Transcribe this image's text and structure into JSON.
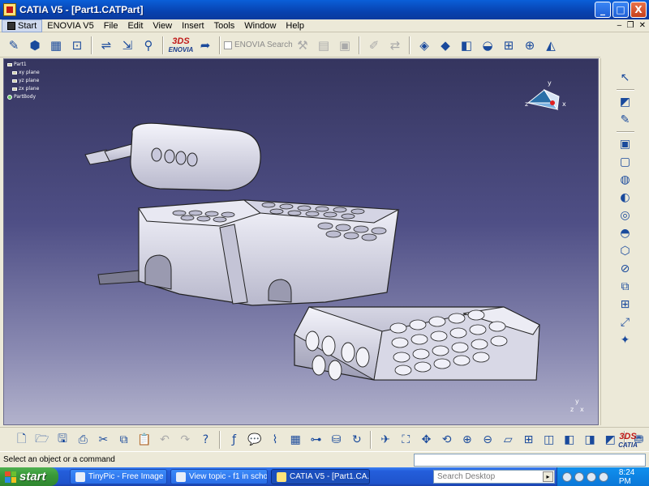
{
  "window": {
    "title": "CATIA V5 - [Part1.CATPart]",
    "buttons": {
      "minimize": "_",
      "maximize": "□",
      "close": "X"
    }
  },
  "menu": {
    "items": [
      "Start",
      "ENOVIA V5",
      "File",
      "Edit",
      "View",
      "Insert",
      "Tools",
      "Window",
      "Help"
    ]
  },
  "toolbar": {
    "enovia_logo": "ENOVIA",
    "enovia_search": "ENOVIA Search ..."
  },
  "spec_tree": {
    "root": "Part1",
    "children": [
      "xy plane",
      "yz plane",
      "zx plane",
      "PartBody"
    ]
  },
  "compass": {
    "y": "y",
    "x": "x",
    "z": "z"
  },
  "axis": {
    "y": "y",
    "z": "z",
    "x": "x"
  },
  "logo": {
    "catia": "CATIA"
  },
  "status": {
    "prompt": "Select an object or a command",
    "command_value": ""
  },
  "taskbar": {
    "start": "start",
    "tasks": [
      {
        "label": "TinyPic - Free Image ...",
        "active": false
      },
      {
        "label": "View topic - f1 in scho...",
        "active": false
      },
      {
        "label": "CATIA V5 - [Part1.CA...",
        "active": true
      }
    ],
    "search_placeholder": "Search Desktop",
    "clock": "8:24 PM"
  },
  "colors": {
    "viewport_top": "#35355f",
    "viewport_bottom": "#b2b2cc",
    "model_fill": "#e6e6f0",
    "title_blue": "#0a5fd8",
    "start_green": "#3a9a3a"
  }
}
